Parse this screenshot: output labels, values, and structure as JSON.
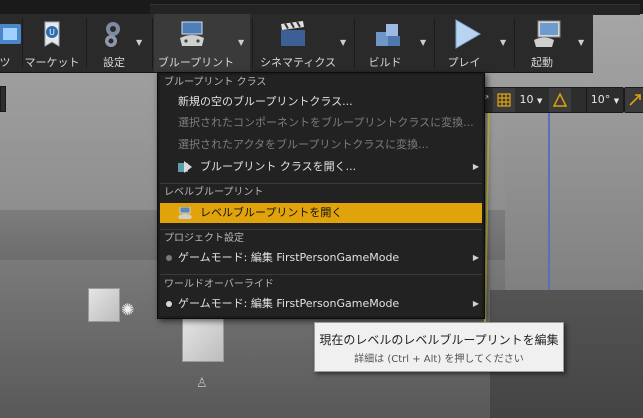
{
  "toolbar": {
    "items": [
      {
        "id": "partial-left",
        "label": "ツ"
      },
      {
        "id": "marketplace",
        "label": "マーケット"
      },
      {
        "id": "settings",
        "label": "設定"
      },
      {
        "id": "blueprints",
        "label": "ブループリント"
      },
      {
        "id": "cinematics",
        "label": "シネマティクス"
      },
      {
        "id": "build",
        "label": "ビルド"
      },
      {
        "id": "play",
        "label": "プレイ"
      },
      {
        "id": "launch",
        "label": "起動"
      }
    ]
  },
  "viewport_toolbar": {
    "grid_snap_value": "10",
    "rotation_snap_value": "10°"
  },
  "menu": {
    "sections": [
      {
        "header": "ブループリント クラス",
        "items": [
          {
            "label": "新規の空のブループリントクラス...",
            "enabled": true
          },
          {
            "label": "選択されたコンポーネントをブループリントクラスに変換...",
            "enabled": false
          },
          {
            "label": "選択されたアクタをブループリントクラスに変換...",
            "enabled": false
          },
          {
            "label": "ブループリント クラスを開く...",
            "enabled": true,
            "submenu": true,
            "icon": "open-blueprint-icon"
          }
        ]
      },
      {
        "header": "レベルブループリント",
        "items": [
          {
            "label": "レベルブループリントを開く",
            "enabled": true,
            "highlighted": true,
            "icon": "level-blueprint-icon"
          }
        ]
      },
      {
        "header": "プロジェクト設定",
        "items": [
          {
            "label": "ゲームモード: 編集 FirstPersonGameMode",
            "enabled": true,
            "submenu": true,
            "dot_color": "#7a7a7a"
          }
        ]
      },
      {
        "header": "ワールドオーバーライド",
        "items": [
          {
            "label": "ゲームモード: 編集 FirstPersonGameMode",
            "enabled": true,
            "submenu": true,
            "dot_color": "#d8d8d8"
          }
        ]
      }
    ]
  },
  "tooltip": {
    "title": "現在のレベルのレベルブループリントを編集",
    "hint": "詳細は (Ctrl + Alt) を押してください"
  },
  "colors": {
    "highlight": "#e1a30b",
    "menu_bg": "#222222",
    "toolbar_bg": "#2a2a2a"
  }
}
